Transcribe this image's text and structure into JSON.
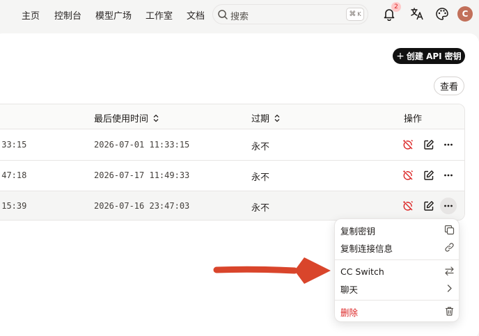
{
  "nav": {
    "items": [
      "主页",
      "控制台",
      "模型广场",
      "工作室",
      "文档"
    ],
    "search_placeholder": "搜索",
    "shortcut_symbol": "⌘",
    "shortcut_key": "K",
    "notification_count": "2",
    "avatar_letter": "C"
  },
  "toolbar": {
    "create_label": "创建 API 密钥",
    "create_plus": "+",
    "view_label": "查看"
  },
  "table": {
    "columns": {
      "last_used": "最后使用时间",
      "expiry": "过期",
      "actions": "操作"
    },
    "rows": [
      {
        "created_tail": ":33:15",
        "last_used": "2026-07-01 11:33:15",
        "expiry": "永不"
      },
      {
        "created_tail": ":47:18",
        "last_used": "2026-07-17 11:49:33",
        "expiry": "永不"
      },
      {
        "created_tail": ":15:39",
        "last_used": "2026-07-16 23:47:03",
        "expiry": "永不"
      }
    ]
  },
  "menu": {
    "copy_key": "复制密钥",
    "copy_connection": "复制连接信息",
    "cc_switch": "CC Switch",
    "chat": "聊天",
    "delete": "删除"
  },
  "colors": {
    "accent_dark": "#111111",
    "danger": "#dc2626",
    "annotation_arrow": "#d9452b"
  }
}
